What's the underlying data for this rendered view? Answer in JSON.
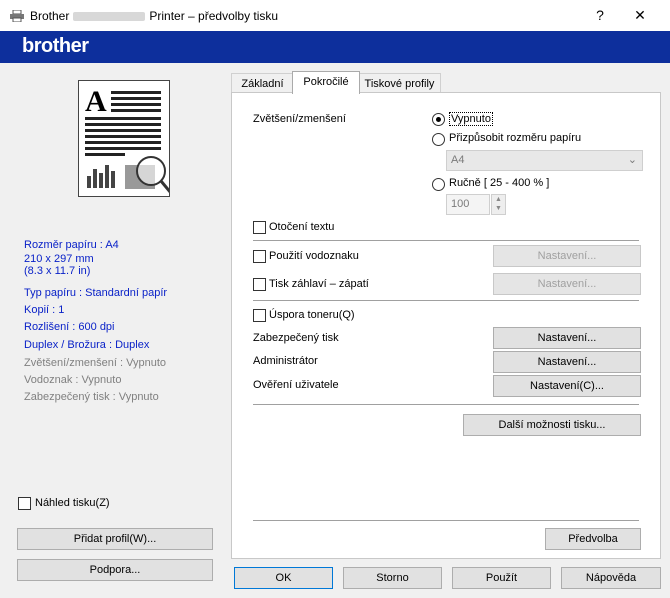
{
  "window": {
    "title_prefix": "Brother",
    "title_suffix": "Printer – předvolby tisku",
    "help_glyph": "?",
    "close_glyph": "✕"
  },
  "banner": {
    "logo_text": "brother",
    "color": "#0d2f9c"
  },
  "left_panel": {
    "paper_size": "Rozměr papíru : A4",
    "paper_dims_mm": "210 x 297 mm",
    "paper_dims_in": "(8.3 x 11.7 in)",
    "paper_type": "Typ papíru : Standardní papír",
    "copies": "Kopií : 1",
    "resolution": "Rozlišení : 600 dpi",
    "duplex": "Duplex / Brožura : Duplex",
    "scaling": "Zvětšení/zmenšení : Vypnuto",
    "watermark": "Vodoznak : Vypnuto",
    "secure_print": "Zabezpečený tisk : Vypnuto",
    "print_preview_label": "Náhled tisku(Z)",
    "add_profile_button": "Přidat profil(W)...",
    "support_button": "Podpora..."
  },
  "tabs": [
    {
      "label": "Základní"
    },
    {
      "label": "Pokročilé"
    },
    {
      "label": "Tiskové profily"
    }
  ],
  "advanced": {
    "scaling_label": "Zvětšení/zmenšení",
    "radio_off": "Vypnuto",
    "radio_fit": "Přizpůsobit rozměru papíru",
    "paper_select_value": "A4",
    "radio_manual": "Ručně [ 25 - 400 % ]",
    "manual_value": "100",
    "rotate_text": "Otočení textu",
    "watermark_label": "Použití vodoznaku",
    "watermark_settings": "Nastavení...",
    "header_footer_label": "Tisk záhlaví – zápatí",
    "header_footer_settings": "Nastavení...",
    "toner_save": "Úspora toneru(Q)",
    "secure_print": "Zabezpečený tisk",
    "secure_print_settings": "Nastavení...",
    "admin": "Administrátor",
    "admin_settings": "Nastavení...",
    "user_auth": "Ověření uživatele",
    "user_auth_settings": "Nastavení(C)...",
    "more_options": "Další možnosti tisku...",
    "defaults": "Předvolba"
  },
  "footer": {
    "ok": "OK",
    "cancel": "Storno",
    "apply": "Použít",
    "help": "Nápověda"
  }
}
